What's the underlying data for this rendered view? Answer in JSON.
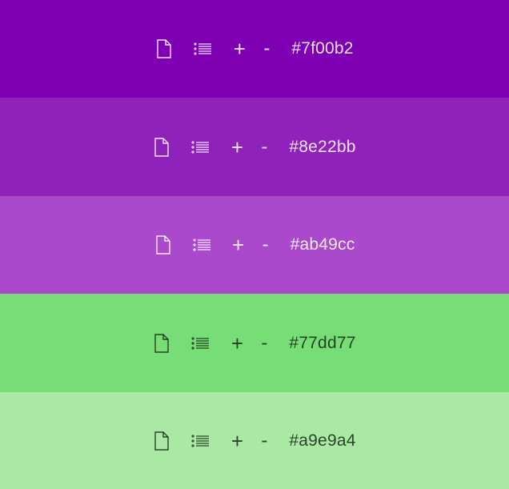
{
  "swatches": [
    {
      "hex": "#7f00b2",
      "color": "#7f00b2",
      "tone": "light",
      "plus": "+",
      "minus": "-",
      "icons": [
        "document-icon",
        "list-icon"
      ]
    },
    {
      "hex": "#8e22bb",
      "color": "#8e22bb",
      "tone": "light",
      "plus": "+",
      "minus": "-",
      "icons": [
        "document-icon",
        "list-icon"
      ]
    },
    {
      "hex": "#ab49cc",
      "color": "#ab49cc",
      "tone": "light",
      "plus": "+",
      "minus": "-",
      "icons": [
        "document-icon",
        "list-icon"
      ]
    },
    {
      "hex": "#77dd77",
      "color": "#77dd77",
      "tone": "dark",
      "plus": "+",
      "minus": "-",
      "icons": [
        "document-icon",
        "list-icon"
      ]
    },
    {
      "hex": "#a9e9a4",
      "color": "#a9e9a4",
      "tone": "dark",
      "plus": "+",
      "minus": "-",
      "icons": [
        "document-icon",
        "list-icon"
      ]
    }
  ]
}
